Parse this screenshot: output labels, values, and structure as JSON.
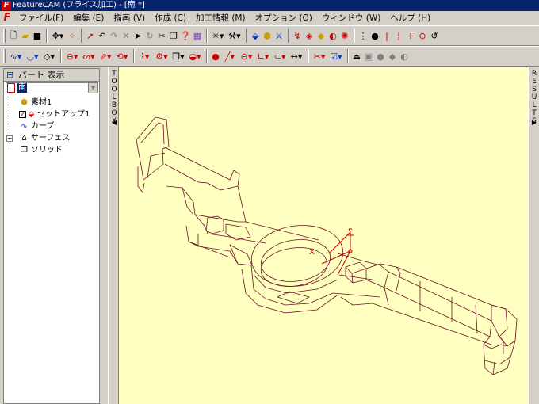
{
  "window": {
    "title": "FeatureCAM (フライス加工) - [南 *]"
  },
  "menu": {
    "items": [
      "ファイル(F)",
      "編集 (E)",
      "描画 (V)",
      "作成 (C)",
      "加工情報 (M)",
      "オプション (O)",
      "ウィンドウ (W)",
      "ヘルプ (H)"
    ]
  },
  "part_panel": {
    "title": "パート 表示",
    "selected_part": "南",
    "tree": [
      {
        "label": "素材1",
        "icon": "stock-icon",
        "color": "#c8a000"
      },
      {
        "label": "セットアップ1",
        "icon": "setup-icon",
        "color": "#c00000"
      },
      {
        "label": "カーブ",
        "icon": "curve-icon",
        "color": "#0033cc"
      },
      {
        "label": "サーフェス",
        "icon": "surface-icon",
        "color": "#000000"
      },
      {
        "label": "ソリッド",
        "icon": "solid-icon",
        "color": "#000000"
      }
    ]
  },
  "side_tabs": {
    "toolbox": "TOOLBOX",
    "results": "RESULTS"
  },
  "viewport": {
    "background": "#ffffc0",
    "wire_color": "#6a1028",
    "axis_x_label": "X"
  },
  "colors": {
    "title_bg": "#08246b",
    "chrome": "#d4d0c8",
    "accent_red": "#c00000"
  }
}
